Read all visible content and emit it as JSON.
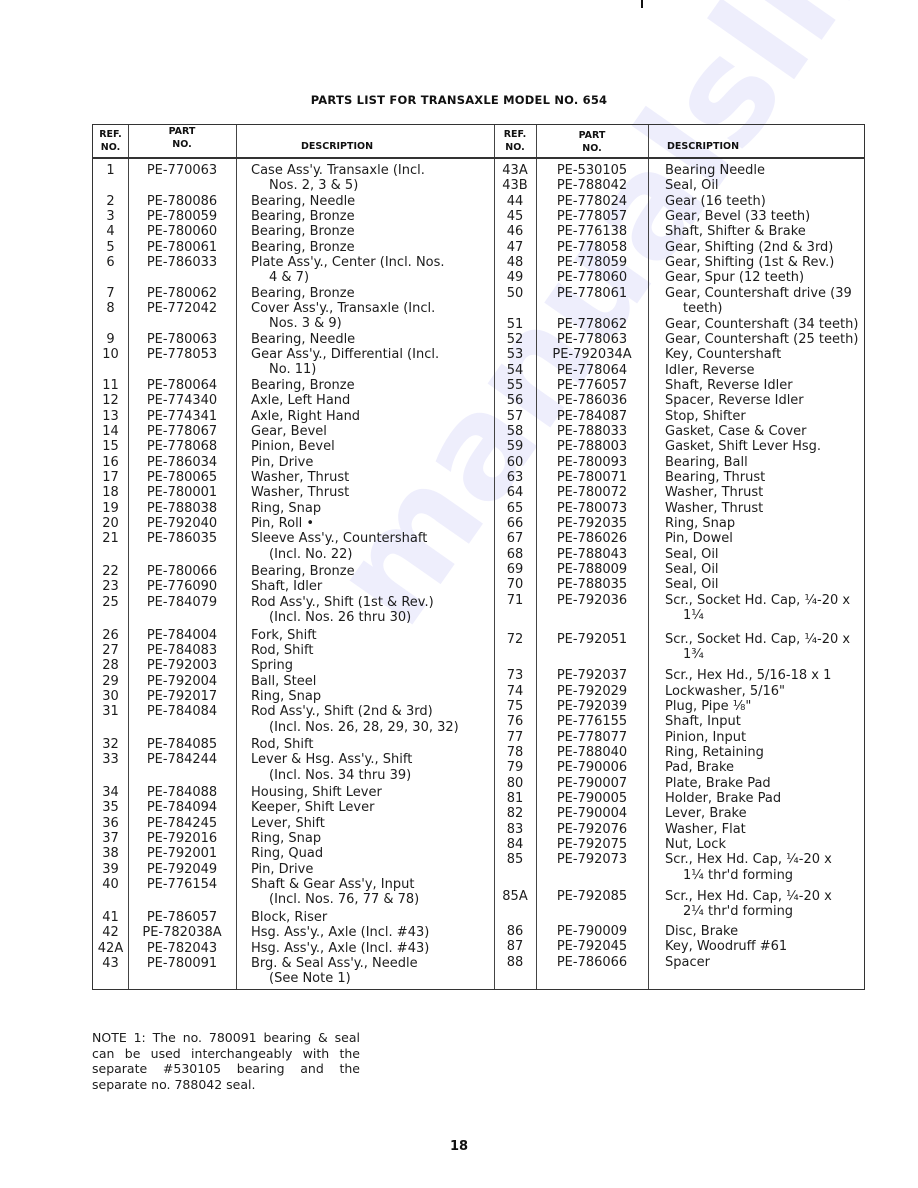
{
  "page": {
    "title": "PARTS LIST FOR TRANSAXLE MODEL NO. 654",
    "page_number": "18",
    "watermark": "manualslib.com"
  },
  "table": {
    "headers": {
      "ref_line1": "REF.",
      "ref_line2": "NO.",
      "part_line1": "PART",
      "part_line2": "NO.",
      "description": "DESCRIPTION"
    },
    "left": [
      {
        "ref": "1",
        "part": "PE-770063",
        "desc": [
          "Case Ass'y. Transaxle (Incl.",
          "Nos. 2, 3 & 5)"
        ]
      },
      {
        "ref": "2",
        "part": "PE-780086",
        "desc": [
          "Bearing, Needle"
        ]
      },
      {
        "ref": "3",
        "part": "PE-780059",
        "desc": [
          "Bearing, Bronze"
        ]
      },
      {
        "ref": "4",
        "part": "PE-780060",
        "desc": [
          "Bearing, Bronze"
        ]
      },
      {
        "ref": "5",
        "part": "PE-780061",
        "desc": [
          "Bearing, Bronze"
        ]
      },
      {
        "ref": "6",
        "part": "PE-786033",
        "desc": [
          "Plate Ass'y., Center (Incl. Nos.",
          "4 & 7)"
        ]
      },
      {
        "ref": "7",
        "part": "PE-780062",
        "desc": [
          "Bearing, Bronze"
        ]
      },
      {
        "ref": "8",
        "part": "PE-772042",
        "desc": [
          "Cover Ass'y., Transaxle (Incl.",
          "Nos. 3 & 9)"
        ]
      },
      {
        "ref": "9",
        "part": "PE-780063",
        "desc": [
          "Bearing, Needle"
        ]
      },
      {
        "ref": "10",
        "part": "PE-778053",
        "desc": [
          "Gear Ass'y., Differential (Incl.",
          "No. 11)"
        ]
      },
      {
        "ref": "11",
        "part": "PE-780064",
        "desc": [
          "Bearing, Bronze"
        ]
      },
      {
        "ref": "12",
        "part": "PE-774340",
        "desc": [
          "Axle, Left Hand"
        ]
      },
      {
        "ref": "13",
        "part": "PE-774341",
        "desc": [
          "Axle, Right Hand"
        ]
      },
      {
        "ref": "14",
        "part": "PE-778067",
        "desc": [
          "Gear, Bevel"
        ]
      },
      {
        "ref": "15",
        "part": "PE-778068",
        "desc": [
          "Pinion, Bevel"
        ]
      },
      {
        "ref": "16",
        "part": "PE-786034",
        "desc": [
          "Pin, Drive"
        ]
      },
      {
        "ref": "17",
        "part": "PE-780065",
        "desc": [
          "Washer, Thrust"
        ]
      },
      {
        "ref": "18",
        "part": "PE-780001",
        "desc": [
          "Washer, Thrust"
        ]
      },
      {
        "ref": "19",
        "part": "PE-788038",
        "desc": [
          "Ring, Snap"
        ]
      },
      {
        "ref": "20",
        "part": "PE-792040",
        "desc": [
          "Pin, Roll •"
        ]
      },
      {
        "ref": "21",
        "part": "PE-786035",
        "desc": [
          "Sleeve Ass'y., Countershaft",
          "(Incl. No. 22)"
        ]
      },
      {
        "ref": "22",
        "part": "PE-780066",
        "desc": [
          "Bearing, Bronze"
        ]
      },
      {
        "ref": "23",
        "part": "PE-776090",
        "desc": [
          "Shaft, Idler"
        ]
      },
      {
        "ref": "25",
        "part": "PE-784079",
        "desc": [
          "Rod Ass'y., Shift (1st & Rev.)",
          "(Incl. Nos. 26 thru 30)"
        ]
      },
      {
        "ref": "26",
        "part": "PE-784004",
        "desc": [
          "Fork, Shift"
        ]
      },
      {
        "ref": "27",
        "part": "PE-784083",
        "desc": [
          "Rod, Shift"
        ]
      },
      {
        "ref": "28",
        "part": "PE-792003",
        "desc": [
          "Spring"
        ]
      },
      {
        "ref": "29",
        "part": "PE-792004",
        "desc": [
          "Ball, Steel"
        ]
      },
      {
        "ref": "30",
        "part": "PE-792017",
        "desc": [
          "Ring, Snap"
        ]
      },
      {
        "ref": "31",
        "part": "PE-784084",
        "desc": [
          "Rod Ass'y., Shift (2nd & 3rd)",
          "(Incl. Nos. 26, 28, 29, 30, 32)"
        ]
      },
      {
        "ref": "32",
        "part": "PE-784085",
        "desc": [
          "Rod, Shift"
        ]
      },
      {
        "ref": "33",
        "part": "PE-784244",
        "desc": [
          "Lever & Hsg. Ass'y., Shift",
          "(Incl. Nos. 34 thru 39)"
        ]
      },
      {
        "ref": "34",
        "part": "PE-784088",
        "desc": [
          "Housing, Shift Lever"
        ]
      },
      {
        "ref": "35",
        "part": "PE-784094",
        "desc": [
          "Keeper, Shift Lever"
        ]
      },
      {
        "ref": "36",
        "part": "PE-784245",
        "desc": [
          "Lever, Shift"
        ]
      },
      {
        "ref": "37",
        "part": "PE-792016",
        "desc": [
          "Ring, Snap"
        ]
      },
      {
        "ref": "38",
        "part": "PE-792001",
        "desc": [
          "Ring, Quad"
        ]
      },
      {
        "ref": "39",
        "part": "PE-792049",
        "desc": [
          "Pin, Drive"
        ]
      },
      {
        "ref": "40",
        "part": "PE-776154",
        "desc": [
          "Shaft & Gear Ass'y, Input",
          "(Incl. Nos. 76, 77 & 78)"
        ]
      },
      {
        "ref": "41",
        "part": "PE-786057",
        "desc": [
          "Block, Riser"
        ]
      },
      {
        "ref": "42",
        "part": "PE-782038A",
        "desc": [
          "Hsg. Ass'y., Axle (Incl. #43)"
        ]
      },
      {
        "ref": "42A",
        "part": "PE-782043",
        "desc": [
          "Hsg. Ass'y., Axle (Incl. #43)"
        ]
      },
      {
        "ref": "43",
        "part": "PE-780091",
        "desc": [
          "Brg. & Seal Ass'y., Needle",
          "(See Note 1)"
        ]
      }
    ],
    "right": [
      {
        "ref": "43A",
        "part": "PE-530105",
        "desc": [
          "Bearing Needle"
        ]
      },
      {
        "ref": "43B",
        "part": "PE-788042",
        "desc": [
          "Seal, Oil"
        ]
      },
      {
        "ref": "44",
        "part": "PE-778024",
        "desc": [
          "Gear (16 teeth)"
        ]
      },
      {
        "ref": "45",
        "part": "PE-778057",
        "desc": [
          "Gear, Bevel (33 teeth)"
        ]
      },
      {
        "ref": "46",
        "part": "PE-776138",
        "desc": [
          "Shaft, Shifter & Brake"
        ]
      },
      {
        "ref": "47",
        "part": "PE-778058",
        "desc": [
          "Gear, Shifting (2nd & 3rd)"
        ]
      },
      {
        "ref": "48",
        "part": "PE-778059",
        "desc": [
          "Gear, Shifting (1st & Rev.)"
        ]
      },
      {
        "ref": "49",
        "part": "PE-778060",
        "desc": [
          "Gear, Spur (12 teeth)"
        ]
      },
      {
        "ref": "50",
        "part": "PE-778061",
        "desc": [
          "Gear, Countershaft drive (39",
          "teeth)"
        ]
      },
      {
        "ref": "51",
        "part": "PE-778062",
        "desc": [
          "Gear, Countershaft (34 teeth)"
        ]
      },
      {
        "ref": "52",
        "part": "PE-778063",
        "desc": [
          "Gear, Countershaft (25 teeth)"
        ]
      },
      {
        "ref": "53",
        "part": "PE-792034A",
        "desc": [
          "Key, Countershaft"
        ]
      },
      {
        "ref": "54",
        "part": "PE-778064",
        "desc": [
          "Idler, Reverse"
        ]
      },
      {
        "ref": "55",
        "part": "PE-776057",
        "desc": [
          "Shaft, Reverse Idler"
        ]
      },
      {
        "ref": "56",
        "part": "PE-786036",
        "desc": [
          "Spacer, Reverse Idler"
        ]
      },
      {
        "ref": "57",
        "part": "PE-784087",
        "desc": [
          "Stop, Shifter"
        ]
      },
      {
        "ref": "58",
        "part": "PE-788033",
        "desc": [
          "Gasket, Case & Cover"
        ]
      },
      {
        "ref": "59",
        "part": "PE-788003",
        "desc": [
          "Gasket, Shift Lever Hsg."
        ]
      },
      {
        "ref": "60",
        "part": "PE-780093",
        "desc": [
          "Bearing, Ball"
        ]
      },
      {
        "ref": "63",
        "part": "PE-780071",
        "desc": [
          "Bearing, Thrust"
        ]
      },
      {
        "ref": "64",
        "part": "PE-780072",
        "desc": [
          "Washer, Thrust"
        ]
      },
      {
        "ref": "65",
        "part": "PE-780073",
        "desc": [
          "Washer, Thrust"
        ]
      },
      {
        "ref": "66",
        "part": "PE-792035",
        "desc": [
          "Ring, Snap"
        ]
      },
      {
        "ref": "67",
        "part": "PE-786026",
        "desc": [
          "Pin, Dowel"
        ]
      },
      {
        "ref": "68",
        "part": "PE-788043",
        "desc": [
          "Seal, Oil"
        ]
      },
      {
        "ref": "69",
        "part": "PE-788009",
        "desc": [
          "Seal, Oil"
        ]
      },
      {
        "ref": "70",
        "part": "PE-788035",
        "desc": [
          "Seal, Oil"
        ]
      },
      {
        "ref": "71",
        "part": "PE-792036",
        "desc": [
          "Scr., Socket Hd. Cap, ¼-20 x",
          "1¼"
        ]
      },
      {
        "ref": "72",
        "part": "PE-792051",
        "desc": [
          "Scr., Socket Hd. Cap, ¼-20 x",
          "1¾"
        ]
      },
      {
        "ref": "73",
        "part": "PE-792037",
        "desc": [
          "Scr., Hex Hd., 5/16-18 x 1"
        ]
      },
      {
        "ref": "74",
        "part": "PE-792029",
        "desc": [
          "Lockwasher, 5/16\""
        ]
      },
      {
        "ref": "75",
        "part": "PE-792039",
        "desc": [
          "Plug, Pipe ⅛\""
        ]
      },
      {
        "ref": "76",
        "part": "PE-776155",
        "desc": [
          "Shaft, Input"
        ]
      },
      {
        "ref": "77",
        "part": "PE-778077",
        "desc": [
          "Pinion, Input"
        ]
      },
      {
        "ref": "78",
        "part": "PE-788040",
        "desc": [
          "Ring, Retaining"
        ]
      },
      {
        "ref": "79",
        "part": "PE-790006",
        "desc": [
          "Pad, Brake"
        ]
      },
      {
        "ref": "80",
        "part": "PE-790007",
        "desc": [
          "Plate, Brake Pad"
        ]
      },
      {
        "ref": "81",
        "part": "PE-790005",
        "desc": [
          "Holder, Brake Pad"
        ]
      },
      {
        "ref": "82",
        "part": "PE-790004",
        "desc": [
          "Lever, Brake"
        ]
      },
      {
        "ref": "83",
        "part": "PE-792076",
        "desc": [
          "Washer, Flat"
        ]
      },
      {
        "ref": "84",
        "part": "PE-792075",
        "desc": [
          "Nut, Lock"
        ]
      },
      {
        "ref": "85",
        "part": "PE-792073",
        "desc": [
          "Scr., Hex Hd. Cap, ¼-20 x",
          "1¼ thr'd forming"
        ]
      },
      {
        "ref": "85A",
        "part": "PE-792085",
        "desc": [
          "Scr., Hex Hd. Cap, ¼-20 x",
          "2¼ thr'd forming"
        ]
      },
      {
        "ref": "86",
        "part": "PE-790009",
        "desc": [
          "Disc, Brake"
        ]
      },
      {
        "ref": "87",
        "part": "PE-792045",
        "desc": [
          "Key, Woodruff #61"
        ]
      },
      {
        "ref": "88",
        "part": "PE-786066",
        "desc": [
          "Spacer"
        ]
      }
    ]
  },
  "note": "NOTE 1: The no. 780091 bearing & seal can be used interchangeably with the separate #530105 bearing and the separate no. 788042 seal."
}
